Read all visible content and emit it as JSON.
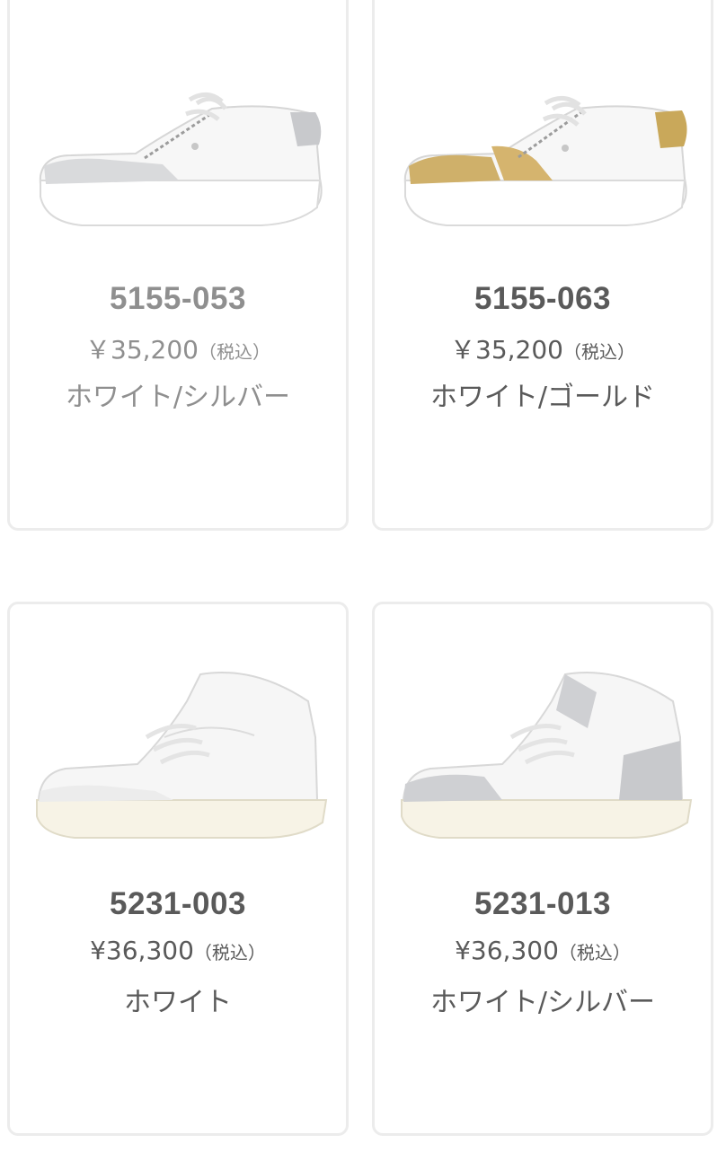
{
  "products": [
    {
      "code": "5155-053",
      "price": "￥35,200",
      "tax": "（税込）",
      "color": "ホワイト/シルバー",
      "accent": "#c8c9cc",
      "shoe": "low-top-sneaker-white-silver"
    },
    {
      "code": "5155-063",
      "price": "￥35,200",
      "tax": "（税込）",
      "color": "ホワイト/ゴールド",
      "accent": "#c9a85a",
      "shoe": "low-top-sneaker-white-gold"
    },
    {
      "code": "5231-003",
      "price": "¥36,300",
      "tax": "（税込）",
      "color": "ホワイト",
      "accent": "#e4e4e4",
      "shoe": "high-top-sneaker-white"
    },
    {
      "code": "5231-013",
      "price": "¥36,300",
      "tax": "（税込）",
      "color": "ホワイト/シルバー",
      "accent": "#c8c9cc",
      "shoe": "high-top-sneaker-white-silver"
    }
  ]
}
